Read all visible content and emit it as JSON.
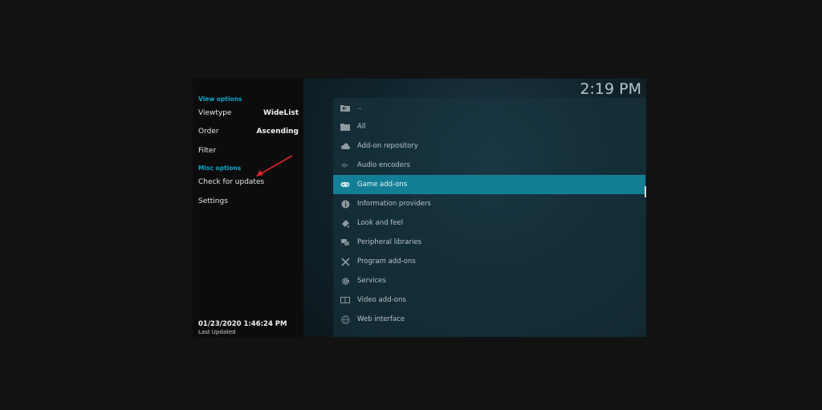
{
  "clock": "2:19 PM",
  "sidebar": {
    "view_options_title": "View options",
    "viewtype_label": "Viewtype",
    "viewtype_value": "WideList",
    "order_label": "Order",
    "order_value": "Ascending",
    "filter_label": "Filter",
    "misc_options_title": "Misc options",
    "check_updates_label": "Check for updates",
    "settings_label": "Settings",
    "last_updated_value": "01/23/2020 1:46:24 PM",
    "last_updated_label": "Last Updated",
    "arrow_color": "#d9262b"
  },
  "list": {
    "items": [
      {
        "label": "..",
        "icon": "back-folder-icon"
      },
      {
        "label": "All",
        "icon": "folder-icon"
      },
      {
        "label": "Add-on repository",
        "icon": "cloud-icon"
      },
      {
        "label": "Audio encoders",
        "icon": "audio-wave-icon"
      },
      {
        "label": "Game add-ons",
        "icon": "gamepad-icon",
        "focused": true
      },
      {
        "label": "Information providers",
        "icon": "info-icon"
      },
      {
        "label": "Look and feel",
        "icon": "paint-icon"
      },
      {
        "label": "Peripheral libraries",
        "icon": "peripheral-icon"
      },
      {
        "label": "Program add-ons",
        "icon": "tools-icon"
      },
      {
        "label": "Services",
        "icon": "gear-icon"
      },
      {
        "label": "Video add-ons",
        "icon": "film-icon"
      },
      {
        "label": "Web interface",
        "icon": "globe-icon"
      }
    ]
  },
  "colors": {
    "accent": "#12a4c6",
    "focus": "#137f96"
  }
}
